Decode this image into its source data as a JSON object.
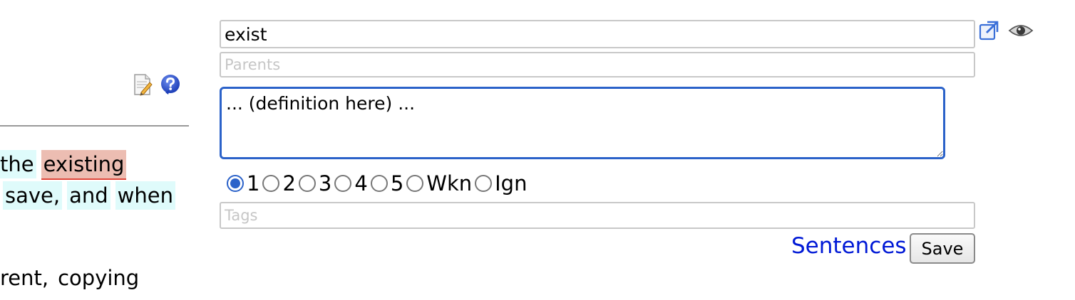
{
  "reading_pane": {
    "lines": [
      {
        "words": [
          {
            "text": "the",
            "status": "known",
            "cut": true
          },
          {
            "text": "existing",
            "status": "learning"
          }
        ]
      },
      {
        "words": [
          {
            "text": "save,",
            "status": "known"
          },
          {
            "text": "and",
            "status": "known"
          },
          {
            "text": "when",
            "status": "known"
          }
        ]
      },
      {
        "words": []
      },
      {
        "words": [
          {
            "text": "rent,",
            "status": "known",
            "cut": true
          },
          {
            "text": "copying",
            "status": "known"
          }
        ]
      }
    ],
    "icons": {
      "edit": "edit-document-icon",
      "help": "help-icon"
    }
  },
  "term_form": {
    "term_value": "exist",
    "parents_placeholder": "Parents",
    "definition_value": "... (definition here) ...",
    "status_options": [
      "1",
      "2",
      "3",
      "4",
      "5",
      "Wkn",
      "Ign"
    ],
    "selected_status": "1",
    "tags_placeholder": "Tags",
    "sentences_label": "Sentences",
    "save_label": "Save",
    "icons": {
      "popout": "external-link-icon",
      "preview": "eye-icon"
    }
  },
  "colors": {
    "known_highlight": "#dffbfb",
    "learning_highlight": "#ecbdb2",
    "learning_underline": "#e0473a",
    "focus_border": "#2b62c9",
    "link": "#0019d6"
  }
}
